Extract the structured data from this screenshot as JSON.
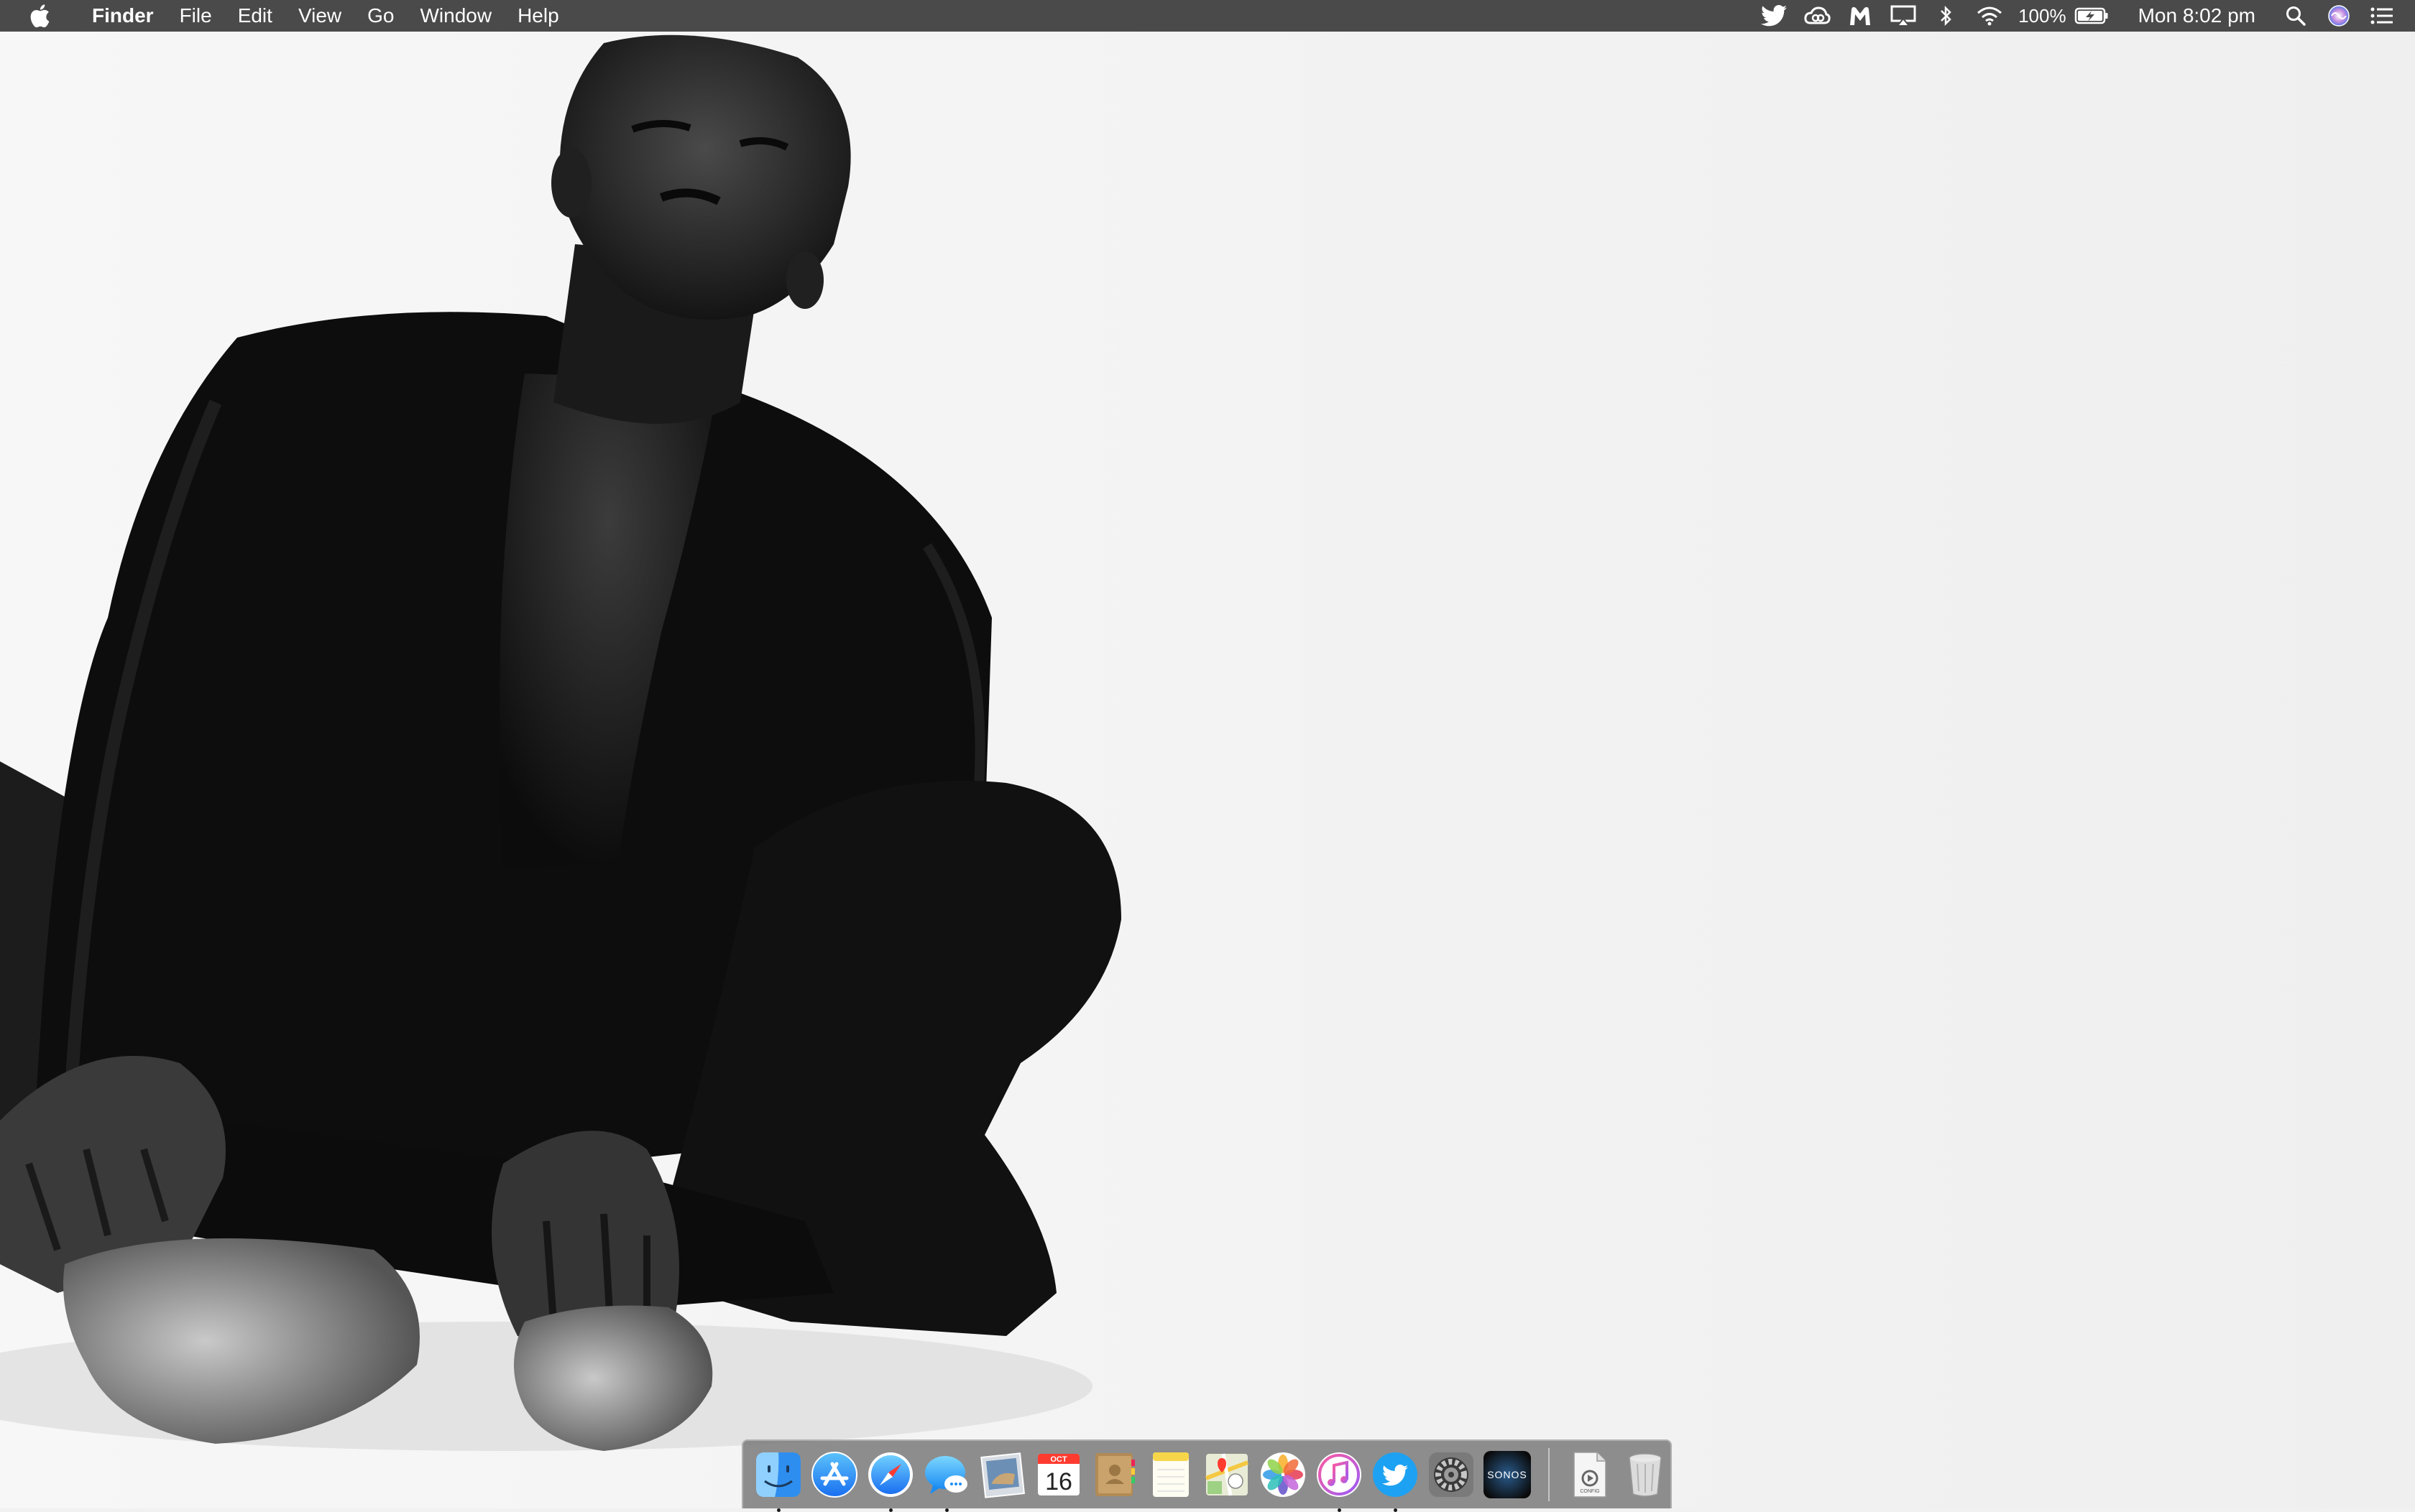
{
  "menubar": {
    "apple_icon": "apple-logo-icon",
    "app_name": "Finder",
    "menus": [
      "File",
      "Edit",
      "View",
      "Go",
      "Window",
      "Help"
    ],
    "status": {
      "icons": [
        "twitter-icon",
        "creative-cloud-icon",
        "malwarebytes-icon",
        "airplay-icon",
        "bluetooth-icon",
        "wifi-icon"
      ],
      "battery_percent": "100%",
      "battery_icon": "battery-charging-icon",
      "clock": "Mon 8:02 pm",
      "trailing_icons": [
        "spotlight-search-icon",
        "siri-icon",
        "notification-center-icon"
      ]
    },
    "colors": {
      "bar": "#4a4a4a",
      "text": "#ffffff"
    }
  },
  "desktop": {
    "wallpaper": "black-and-white-portrait-photo",
    "background": "#f1f1f1"
  },
  "dock": {
    "apps": [
      {
        "icon": "finder-icon",
        "running": true
      },
      {
        "icon": "app-store-icon",
        "running": false
      },
      {
        "icon": "safari-icon",
        "running": true
      },
      {
        "icon": "messages-icon",
        "running": true
      },
      {
        "icon": "mail-icon",
        "running": false
      },
      {
        "icon": "calendar-icon",
        "running": false,
        "month": "OCT",
        "day": "16"
      },
      {
        "icon": "contacts-icon",
        "running": false
      },
      {
        "icon": "notes-icon",
        "running": false
      },
      {
        "icon": "maps-icon",
        "running": false
      },
      {
        "icon": "photos-icon",
        "running": false
      },
      {
        "icon": "itunes-icon",
        "running": true
      },
      {
        "icon": "twitter-icon",
        "running": true
      },
      {
        "icon": "system-preferences-icon",
        "running": false
      },
      {
        "icon": "sonos-icon",
        "running": false,
        "label": "SONOS"
      }
    ],
    "others": [
      {
        "icon": "document-icon",
        "label": "CONFIG"
      },
      {
        "icon": "trash-icon"
      }
    ],
    "colors": {
      "background": "#767676",
      "indicator": "#1a1a1a"
    }
  }
}
